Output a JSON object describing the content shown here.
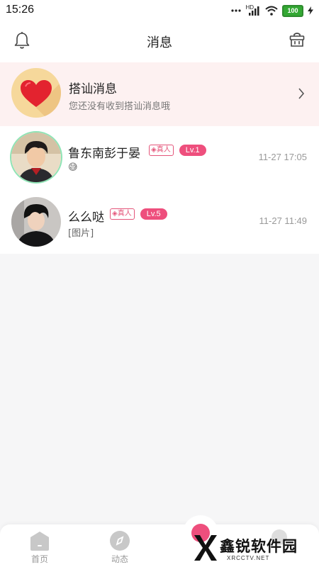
{
  "status_bar": {
    "time": "15:26",
    "network": "HD",
    "battery": "100"
  },
  "header": {
    "title": "消息",
    "left_icon": "bell-icon",
    "right_icon": "shop-basket-icon"
  },
  "pickup": {
    "title": "搭讪消息",
    "subtitle": "您还没有收到搭讪消息哦",
    "icon": "heart-icon"
  },
  "conversations": [
    {
      "name": "鲁东南彭于晏",
      "badge": "真人",
      "level": "Lv.1",
      "time": "11-27 17:05",
      "preview": "😅"
    },
    {
      "name": "么么哒",
      "badge": "真人",
      "level": "Lv.5",
      "time": "11-27 11:49",
      "preview": "[图片]"
    }
  ],
  "bottom_nav": {
    "items": [
      {
        "label": "首页",
        "icon": "home-icon"
      },
      {
        "label": "动态",
        "icon": "compass-icon"
      }
    ]
  },
  "watermark": {
    "title": "鑫锐软件园",
    "subtitle": "XRCCTV.NET"
  },
  "colors": {
    "accent": "#ee4f7d",
    "banner_bg": "#fdf1f1",
    "avatar_ring": "#8ee4b5"
  }
}
